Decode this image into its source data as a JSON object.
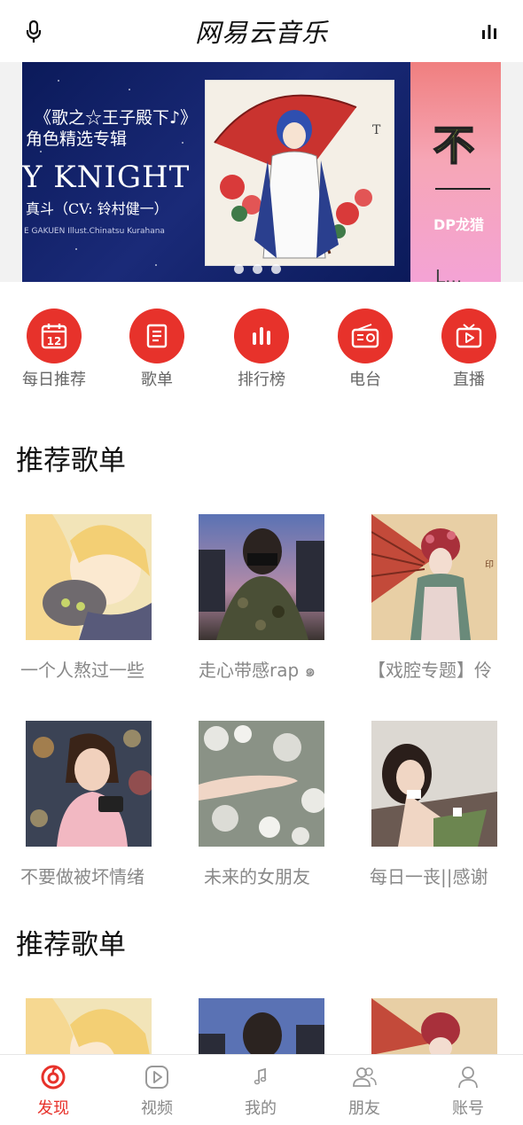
{
  "header": {
    "title": "网易云音乐",
    "left_icon": "microphone-icon",
    "right_icon": "equalizer-icon"
  },
  "banner": {
    "line1": "《歌之☆王子殿下♪》",
    "line2": "角色精选专辑",
    "line3": "Y KNIGHT",
    "line4": "真斗（CV: 铃村健一）",
    "line5": "E GAKUEN Illust.Chinatsu Kurahana",
    "side_line1": "不",
    "side_line2": "DP龙猎",
    "side_line3": "L..."
  },
  "quick_nav": [
    {
      "label": "每日推荐",
      "icon": "calendar-icon",
      "badge": "12"
    },
    {
      "label": "歌单",
      "icon": "playlist-icon"
    },
    {
      "label": "排行榜",
      "icon": "chart-bars-icon"
    },
    {
      "label": "电台",
      "icon": "radio-icon"
    },
    {
      "label": "直播",
      "icon": "tv-play-icon"
    }
  ],
  "sections": [
    {
      "title": "推荐歌单",
      "playlists": [
        {
          "name": "一个人熬过一些"
        },
        {
          "name": "走心带感rap ๑"
        },
        {
          "name": "【戏腔专题】伶"
        },
        {
          "name": "不要做被坏情绪"
        },
        {
          "name": "未来的女朋友"
        },
        {
          "name": "每日一丧||感谢"
        }
      ]
    },
    {
      "title": "推荐歌单"
    }
  ],
  "tabbar": [
    {
      "label": "发现",
      "icon": "netease-logo-icon",
      "active": true
    },
    {
      "label": "视频",
      "icon": "video-play-icon"
    },
    {
      "label": "我的",
      "icon": "music-note-icon"
    },
    {
      "label": "朋友",
      "icon": "friends-icon"
    },
    {
      "label": "账号",
      "icon": "user-icon"
    }
  ],
  "colors": {
    "accent": "#e7322b",
    "text_gray": "#888888"
  }
}
